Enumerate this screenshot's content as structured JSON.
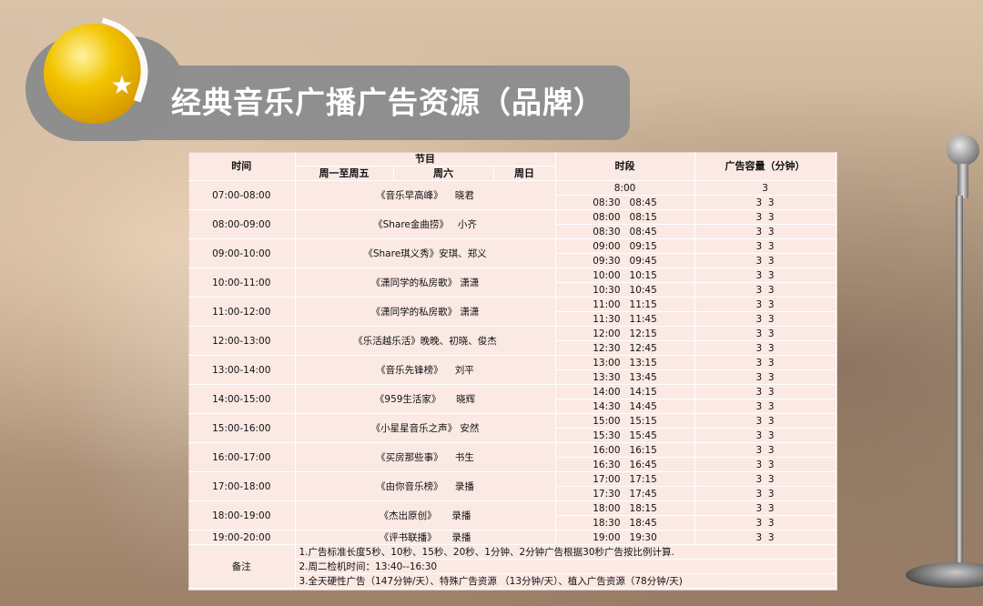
{
  "banner": {
    "title": "经典音乐广播广告资源（品牌）"
  },
  "table": {
    "headers": {
      "time": "时间",
      "program": "节目",
      "weekdays": "周一至周五",
      "saturday": "周六",
      "sunday": "周日",
      "slot": "时段",
      "capacity": "广告容量（分钟）"
    },
    "rows": [
      {
        "time": "07:00-08:00",
        "program": "《音乐早高峰》    晓君",
        "slots": [
          [
            "8:00",
            "3"
          ],
          [
            "08:30   08:45",
            "3  3"
          ]
        ]
      },
      {
        "time": "08:00-09:00",
        "program": "《Share金曲捞》   小齐",
        "slots": [
          [
            "08:00   08:15",
            "3  3"
          ],
          [
            "08:30   08:45",
            "3  3"
          ]
        ]
      },
      {
        "time": "09:00-10:00",
        "program": "《Share琪义秀》安琪、郑义",
        "slots": [
          [
            "09:00   09:15",
            "3  3"
          ],
          [
            "09:30   09:45",
            "3  3"
          ]
        ]
      },
      {
        "time": "10:00-11:00",
        "program": "《潇同学的私房歌》 潇潇",
        "slots": [
          [
            "10:00   10:15",
            "3  3"
          ],
          [
            "10:30   10:45",
            "3  3"
          ]
        ]
      },
      {
        "time": "11:00-12:00",
        "program": "《潇同学的私房歌》 潇潇",
        "slots": [
          [
            "11:00   11:15",
            "3  3"
          ],
          [
            "11:30   11:45",
            "3  3"
          ]
        ]
      },
      {
        "time": "12:00-13:00",
        "program": "《乐活越乐活》晚晚、初晓、俊杰",
        "slots": [
          [
            "12:00   12:15",
            "3  3"
          ],
          [
            "12:30   12:45",
            "3  3"
          ]
        ]
      },
      {
        "time": "13:00-14:00",
        "program": "《音乐先锋榜》    刘平",
        "slots": [
          [
            "13:00   13:15",
            "3  3"
          ],
          [
            "13:30   13:45",
            "3  3"
          ]
        ]
      },
      {
        "time": "14:00-15:00",
        "program": "《959生活家》     晓辉",
        "slots": [
          [
            "14:00   14:15",
            "3  3"
          ],
          [
            "14:30   14:45",
            "3  3"
          ]
        ]
      },
      {
        "time": "15:00-16:00",
        "program": "《小星星音乐之声》 安然",
        "slots": [
          [
            "15:00   15:15",
            "3  3"
          ],
          [
            "15:30   15:45",
            "3  3"
          ]
        ]
      },
      {
        "time": "16:00-17:00",
        "program": "《买房那些事》    书生",
        "slots": [
          [
            "16:00   16:15",
            "3  3"
          ],
          [
            "16:30   16:45",
            "3  3"
          ]
        ]
      },
      {
        "time": "17:00-18:00",
        "program": "《由你音乐榜》    录播",
        "slots": [
          [
            "17:00   17:15",
            "3  3"
          ],
          [
            "17:30   17:45",
            "3  3"
          ]
        ]
      },
      {
        "time": "18:00-19:00",
        "program": "《杰出原创》     录播",
        "slots": [
          [
            "18:00   18:15",
            "3  3"
          ],
          [
            "18:30   18:45",
            "3  3"
          ]
        ]
      },
      {
        "time": "19:00-20:00",
        "program": "《评书联播》     录播",
        "slots": [
          [
            "19:00   19:30",
            "3  3"
          ]
        ]
      }
    ],
    "notes": {
      "label": "备注",
      "lines": [
        "1.广告标准长度5秒、10秒、15秒、20秒、1分钟、2分钟广告根据30秒广告按比例计算.",
        "2.周二检机时间：13:40--16:30",
        "3.全天硬性广告（147分钟/天）、特殊广告资源 （13分钟/天）、植入广告资源（78分钟/天)"
      ]
    }
  }
}
